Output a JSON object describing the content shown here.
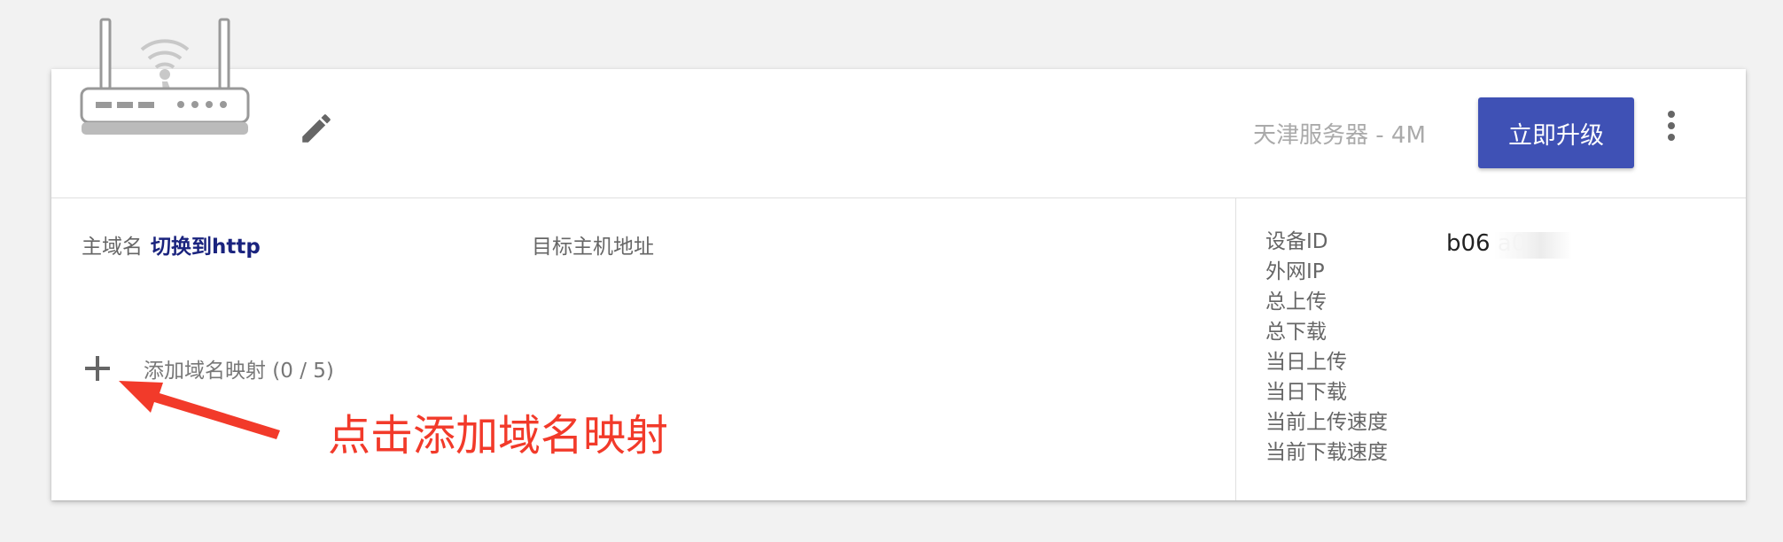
{
  "header": {
    "server_label": "天津服务器 - 4M",
    "upgrade_label": "立即升级"
  },
  "mapping": {
    "domain_label": "主域名",
    "switch_link": "切换到http",
    "target_label": "目标主机地址",
    "add_label": "添加域名映射 (0 / 5)"
  },
  "annotation": {
    "text": "点击添加域名映射",
    "color": "#f23a2a"
  },
  "device_info": {
    "labels": [
      "设备ID",
      "外网IP",
      "总上传",
      "总下载",
      "当日上传",
      "当日下载",
      "当前上传速度",
      "当前下载速度"
    ],
    "device_id": "b06          a0"
  },
  "colors": {
    "accent": "#3f51b5",
    "link": "#1a237e",
    "background": "#f2f2f2"
  },
  "icons": [
    "router-icon",
    "pencil-icon",
    "more-vert-icon",
    "plus-icon",
    "arrow-icon"
  ]
}
